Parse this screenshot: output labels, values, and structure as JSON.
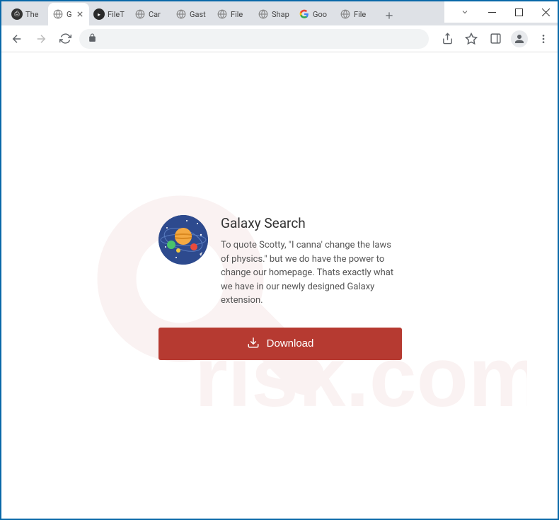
{
  "window": {
    "tabs": [
      {
        "title": "The",
        "favicon": "printer"
      },
      {
        "title": "G",
        "favicon": "globe",
        "active": true
      },
      {
        "title": "FileT",
        "favicon": "filetypeadvisor"
      },
      {
        "title": "Car",
        "favicon": "globe"
      },
      {
        "title": "Gast",
        "favicon": "globe"
      },
      {
        "title": "File",
        "favicon": "globe"
      },
      {
        "title": "Shap",
        "favicon": "globe"
      },
      {
        "title": "Goo",
        "favicon": "google"
      },
      {
        "title": "File",
        "favicon": "globe"
      }
    ]
  },
  "page": {
    "title": "Galaxy Search",
    "description": "To quote Scotty, \"I canna' change the laws of physics.\" but we do have the power to change our homepage. Thats exactly what we have in our newly designed Galaxy extension.",
    "download_label": "Download"
  }
}
